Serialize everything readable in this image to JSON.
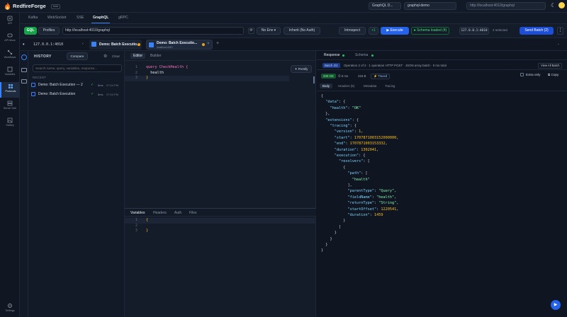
{
  "app": {
    "name": "RedfireForge",
    "badge": "beta"
  },
  "topbar": {
    "workspace": "GraphQL D...",
    "env": "graphql-demo",
    "url": "http://localhost:4010/graphql"
  },
  "rail": {
    "items": [
      {
        "label": "API",
        "icon": "api-icon"
      },
      {
        "label": "API Mock",
        "icon": "mock-icon"
      },
      {
        "label": "Workflows",
        "icon": "workflow-icon"
      },
      {
        "label": "Variables",
        "icon": "variables-icon"
      },
      {
        "label": "Protocols",
        "icon": "protocols-icon"
      },
      {
        "label": "Server Hub",
        "icon": "server-icon"
      },
      {
        "label": "Gallery",
        "icon": "gallery-icon"
      }
    ],
    "settings": "Settings"
  },
  "protocols": [
    "Kafka",
    "WebSocket",
    "SSE",
    "GraphQL",
    "gRPC"
  ],
  "request": {
    "method": "GQL",
    "profiles": "Profiles",
    "url": "http://localhost:4010/graphql",
    "env": "No Env",
    "inherit": "Inherit (No Auth)",
    "introspect": "Introspect",
    "count": "+1",
    "execute": "Execute",
    "schema_status": "Schema loaded (4)",
    "host_chip": "127.0.0.1:4010",
    "selected": "2 selected",
    "send_batch": "Send Batch (2)"
  },
  "tabs": {
    "host": "127.0.0.1:4010",
    "tab1": "Demo: Batch Executio...",
    "tab2_title": "Demo: Batch Executio...",
    "tab2_sub": "localhost:4010"
  },
  "history": {
    "title": "HISTORY",
    "compare": "Compare",
    "clear": "Clear",
    "search_placeholder": "Search name, query, variables, response...",
    "section": "RECENT",
    "items": [
      {
        "name": "Demo: Batch Execution — 2",
        "time": "8ms",
        "stamp": "07:04 PM"
      },
      {
        "name": "Demo: Batch Execution",
        "time": "8ms",
        "stamp": "07:04 PM"
      }
    ]
  },
  "editor": {
    "tabs": [
      "Editor",
      "Builder"
    ],
    "prettify": "Prettify",
    "lines": [
      "query CheckHealth {",
      "  health",
      "}"
    ],
    "bottom_tabs": [
      "Variables",
      "Headers",
      "Auth",
      "Files"
    ],
    "var_lines": [
      "{",
      "",
      "}"
    ]
  },
  "response": {
    "tabs": [
      "Response",
      "Schema"
    ],
    "batch_label": "Batch 2/2",
    "batch_desc": "Operation 2 of 2 · 1 operation HTTP POST · JSON array batch · 0 ms total",
    "view_all": "View All Batch",
    "status": "200 OK",
    "duration": "8 ms",
    "size": "318 B",
    "traced": "Traced",
    "extra_only": "Extra only",
    "copy": "Copy",
    "subtabs": [
      "Body",
      "Headers (5)",
      "Metadata",
      "Tracing"
    ],
    "body": [
      "{",
      "  \"data\": {",
      "    \"health\": \"OK\"",
      "  },",
      "  \"extensions\": {",
      "    \"tracing\": {",
      "      \"version\": 1,",
      "      \"start\": 1707871003152000000,",
      "      \"end\": 1707871003153332,",
      "      \"duration\": 1302041,",
      "      \"execution\": {",
      "        \"resolvers\": [",
      "          {",
      "            \"path\": [",
      "              \"health\"",
      "            ],",
      "            \"parentType\": \"Query\",",
      "            \"fieldName\": \"health\",",
      "            \"returnType\": \"String\",",
      "            \"startOffset\": 1220541,",
      "            \"duration\": 1459",
      "          }",
      "        ]",
      "      }",
      "    }",
      "  }",
      "}"
    ]
  }
}
